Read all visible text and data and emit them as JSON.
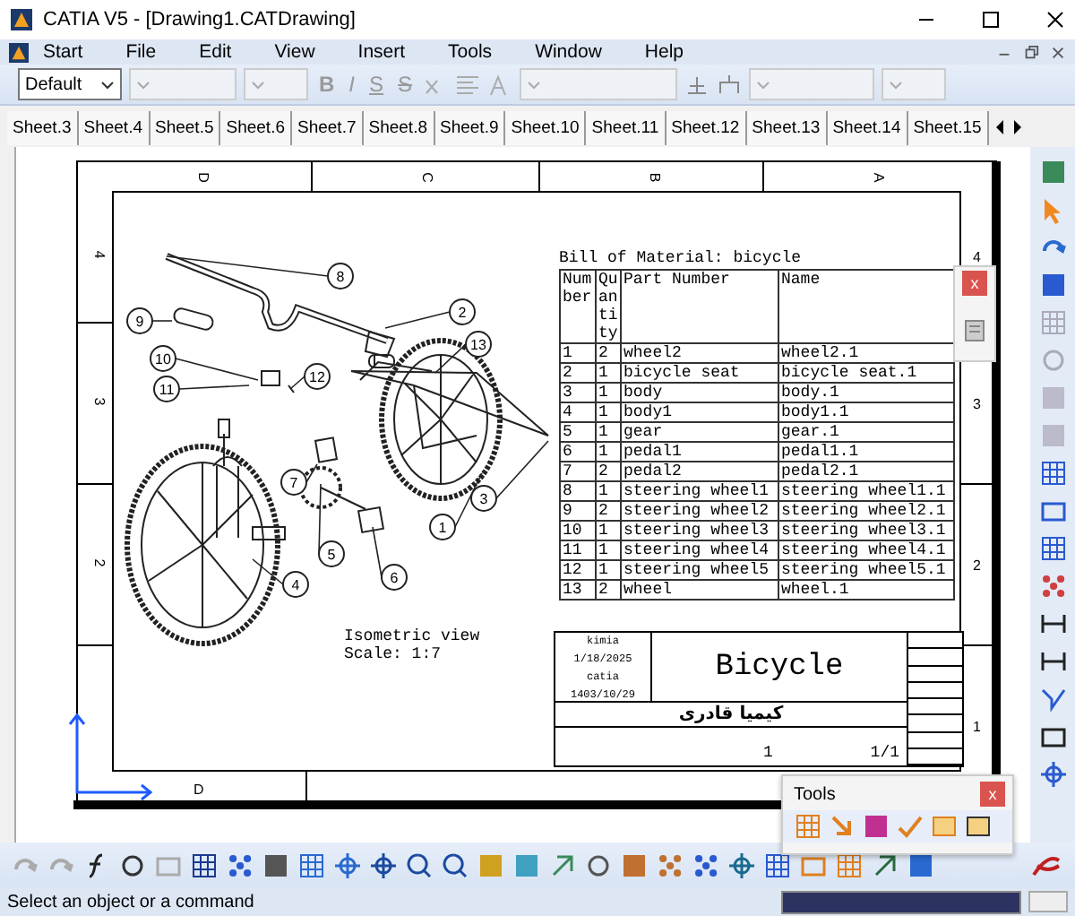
{
  "window": {
    "title": "CATIA V5 - [Drawing1.CATDrawing]"
  },
  "menu": [
    {
      "label": "Start"
    },
    {
      "label": "File"
    },
    {
      "label": "Edit"
    },
    {
      "label": "View"
    },
    {
      "label": "Insert"
    },
    {
      "label": "Tools"
    },
    {
      "label": "Window"
    },
    {
      "label": "Help"
    }
  ],
  "format_toolbar": {
    "style": "Default",
    "buttons": [
      {
        "label": "B",
        "kind": "bold"
      },
      {
        "label": "I",
        "kind": "italic"
      },
      {
        "label": "S",
        "kind": "underline"
      },
      {
        "label": "S",
        "kind": "strike"
      }
    ]
  },
  "sheet_tabs": [
    {
      "label": "Sheet.3",
      "selected": false
    },
    {
      "label": "Sheet.4",
      "selected": false
    },
    {
      "label": "Sheet.5",
      "selected": false
    },
    {
      "label": "Sheet.6",
      "selected": false
    },
    {
      "label": "Sheet.7",
      "selected": false
    },
    {
      "label": "Sheet.8",
      "selected": false
    },
    {
      "label": "Sheet.9",
      "selected": false
    },
    {
      "label": "Sheet.10",
      "selected": false
    },
    {
      "label": "Sheet.11",
      "selected": false
    },
    {
      "label": "Sheet.12",
      "selected": false
    },
    {
      "label": "Sheet.13",
      "selected": false
    },
    {
      "label": "Sheet.14",
      "selected": false
    },
    {
      "label": "Sheet.15",
      "selected": false
    }
  ],
  "drawing": {
    "column_labels": [
      "D",
      "C",
      "B",
      "A"
    ],
    "bottom_column_labels": [
      "D"
    ],
    "left_row_labels": [
      "4",
      "3",
      "2"
    ],
    "right_row_labels": [
      "4",
      "3",
      "2",
      "1"
    ],
    "balloons": [
      {
        "label": "8"
      },
      {
        "label": "9"
      },
      {
        "label": "2"
      },
      {
        "label": "13"
      },
      {
        "label": "10"
      },
      {
        "label": "11"
      },
      {
        "label": "12"
      },
      {
        "label": "7"
      },
      {
        "label": "3"
      },
      {
        "label": "1"
      },
      {
        "label": "5"
      },
      {
        "label": "6"
      },
      {
        "label": "4"
      }
    ],
    "view_caption": [
      "Isometric view",
      "Scale:  1:7"
    ]
  },
  "bom": {
    "title": "Bill of Material: bicycle",
    "columns": [
      "Number",
      "Quantity",
      "Part Number",
      "Name"
    ],
    "rows": [
      [
        "1",
        "2",
        "wheel2",
        "wheel2.1"
      ],
      [
        "2",
        "1",
        "bicycle seat",
        "bicycle seat.1"
      ],
      [
        "3",
        "1",
        "body",
        "body.1"
      ],
      [
        "4",
        "1",
        "body1",
        "body1.1"
      ],
      [
        "5",
        "1",
        "gear",
        "gear.1"
      ],
      [
        "6",
        "1",
        "pedal1",
        "pedal1.1"
      ],
      [
        "7",
        "2",
        "pedal2",
        "pedal2.1"
      ],
      [
        "8",
        "1",
        "steering wheel1",
        "steering wheel1.1"
      ],
      [
        "9",
        "2",
        "steering wheel2",
        "steering wheel2.1"
      ],
      [
        "10",
        "1",
        "steering wheel3",
        "steering wheel3.1"
      ],
      [
        "11",
        "1",
        "steering wheel4",
        "steering wheel4.1"
      ],
      [
        "12",
        "1",
        "steering wheel5",
        "steering wheel5.1"
      ],
      [
        "13",
        "2",
        "wheel",
        "wheel.1"
      ]
    ]
  },
  "title_block": {
    "fields": [
      "kimia",
      "1/18/2025",
      "catia",
      "1403/10/29"
    ],
    "title": "Bicycle",
    "designer": "کیمیا قادری",
    "sheet_number": "1",
    "sheet_count": "1/1"
  },
  "popup": {
    "close": "x"
  },
  "tools_palette": {
    "title": "Tools",
    "close": "x"
  },
  "status_bar": {
    "message": "Select an object or a command"
  }
}
